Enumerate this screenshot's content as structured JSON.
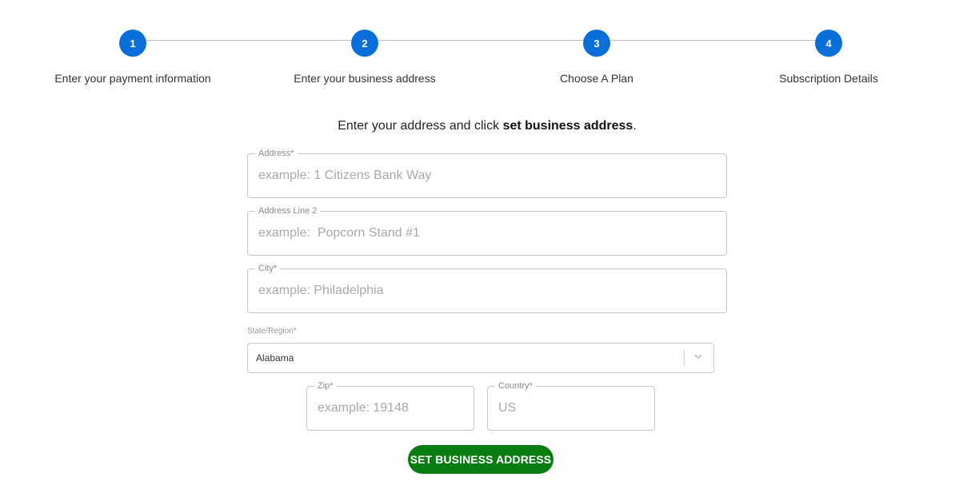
{
  "stepper": {
    "steps": [
      {
        "number": "1",
        "label": "Enter your payment information"
      },
      {
        "number": "2",
        "label": "Enter your business address"
      },
      {
        "number": "3",
        "label": "Choose A Plan"
      },
      {
        "number": "4",
        "label": "Subscription Details"
      }
    ],
    "accent_color": "#0a6fd8"
  },
  "instruction": {
    "prefix": "Enter your address and click ",
    "bold": "set business address",
    "suffix": "."
  },
  "form": {
    "address": {
      "label": "Address*",
      "placeholder": "example: 1 Citizens Bank Way",
      "value": ""
    },
    "address2": {
      "label": "Address Line 2",
      "placeholder": "example:  Popcorn Stand #1",
      "value": ""
    },
    "city": {
      "label": "City*",
      "placeholder": "example: Philadelphia",
      "value": ""
    },
    "state": {
      "label": "State/Region*",
      "selected": "Alabama",
      "icon": "chevron-down-icon"
    },
    "zip": {
      "label": "Zip*",
      "placeholder": "example: 19148",
      "value": ""
    },
    "country": {
      "label": "Country*",
      "placeholder": "US",
      "value": ""
    },
    "submit_label": "SET BUSINESS ADDRESS",
    "submit_color": "#0a7d12"
  }
}
